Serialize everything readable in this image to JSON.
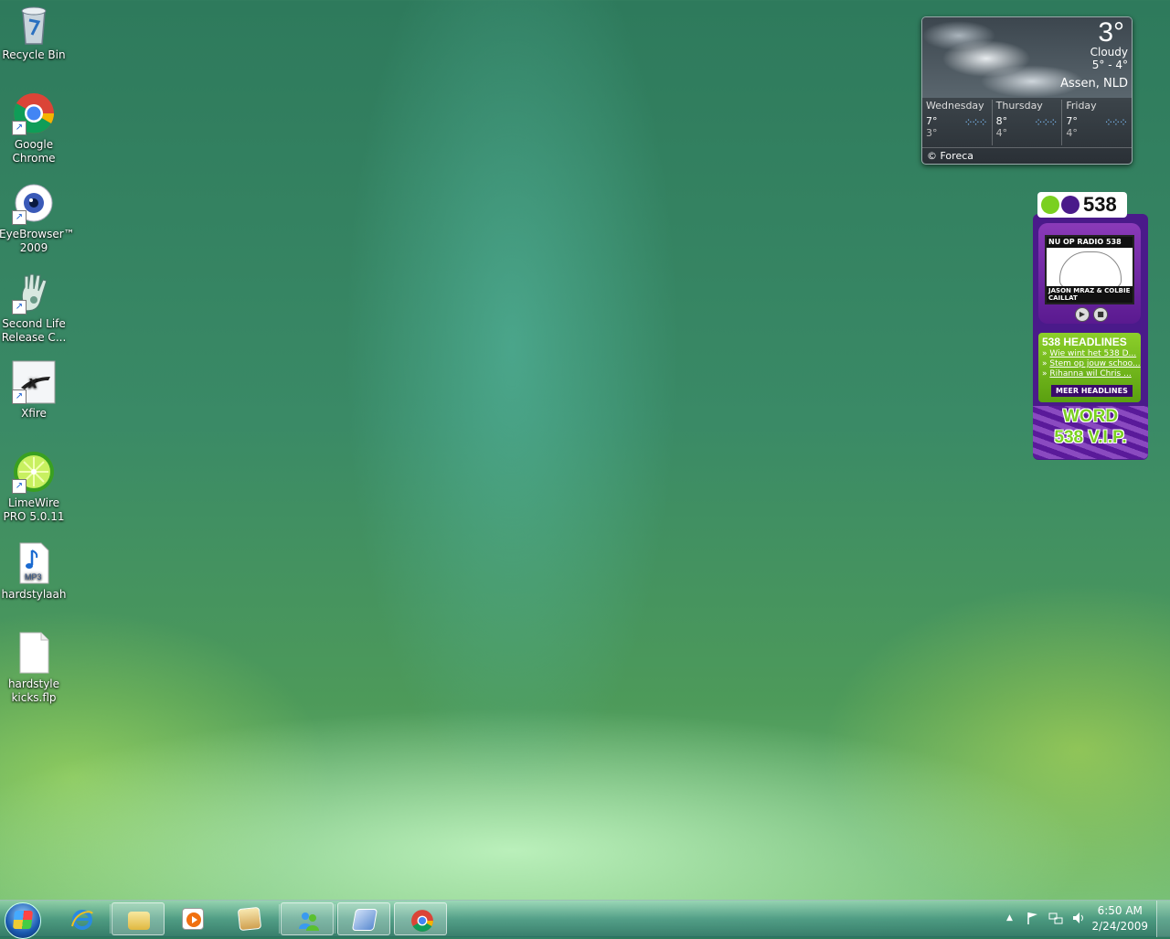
{
  "desktop_icons": [
    {
      "label": "Recycle Bin"
    },
    {
      "label": "Google Chrome"
    },
    {
      "label": "EyeBrowser™ 2009"
    },
    {
      "label": "Second Life Release C..."
    },
    {
      "label": "Xfire"
    },
    {
      "label": "LimeWire PRO 5.0.11"
    },
    {
      "label": "hardstylaah"
    },
    {
      "label": "hardstyle kicks.flp"
    }
  ],
  "weather": {
    "temp": "3°",
    "condition": "Cloudy",
    "range": "5° - 4°",
    "location": "Assen, NLD",
    "forecast": [
      {
        "day": "Wednesday",
        "high": "7°",
        "low": "3°"
      },
      {
        "day": "Thursday",
        "high": "8°",
        "low": "4°"
      },
      {
        "day": "Friday",
        "high": "7°",
        "low": "4°"
      }
    ],
    "credit": "© Foreca"
  },
  "radio538": {
    "logo_text": "538",
    "now_playing_header": "NU OP RADIO 538",
    "now_playing_artist": "JASON MRAZ & COLBIE CAILLAT",
    "headlines_title": "538 HEADLINES",
    "headlines": [
      "Wie wint het 538 D...",
      "Stem op jouw schoo...",
      "Rihanna wil Chris ..."
    ],
    "more_label": "MEER HEADLINES",
    "vip_line1": "WORD",
    "vip_line2": "538 V.I.P."
  },
  "taskbar": {
    "apps": [
      "internet-explorer",
      "windows-explorer",
      "media-player",
      "gallery",
      "messenger",
      "remote-desktop",
      "google-chrome"
    ],
    "clock_time": "6:50 AM",
    "clock_date": "2/24/2009"
  },
  "colors": {
    "desktop_base": "#3a8a66",
    "radio_purple": "#4a1a8a",
    "radio_green": "#7ad020"
  }
}
